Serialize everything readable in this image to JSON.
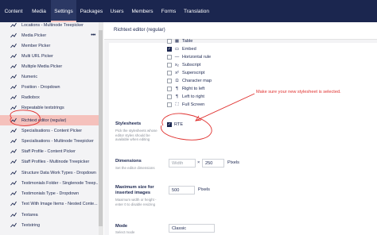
{
  "topnav": {
    "tabs": [
      "Content",
      "Media",
      "Settings",
      "Packages",
      "Users",
      "Members",
      "Forms",
      "Translation"
    ],
    "active": "Settings"
  },
  "sidebar": {
    "items": [
      {
        "label": "Locations - Multinode Treepicker"
      },
      {
        "label": "Media Picker"
      },
      {
        "label": "Member Picker"
      },
      {
        "label": "Multi URL Picker"
      },
      {
        "label": "Multiple Media Picker"
      },
      {
        "label": "Numeric"
      },
      {
        "label": "Position - Dropdown"
      },
      {
        "label": "Radiobox"
      },
      {
        "label": "Repeatable textstrings"
      },
      {
        "label": "Richtext editor (regular)"
      },
      {
        "label": "Specialisations - Content Picker"
      },
      {
        "label": "Specialisations - Multinode Treepicker"
      },
      {
        "label": "Staff Profile - Content Picker"
      },
      {
        "label": "Staff Profiles - Multinode Treepicker"
      },
      {
        "label": "Structure Data Work Types - Dropdown"
      },
      {
        "label": "Testimonials Folder - Singlenode Treep..."
      },
      {
        "label": "Testimonials Type - Dropdown"
      },
      {
        "label": "Text With Image Items - Nested Conte..."
      },
      {
        "label": "Textarea"
      },
      {
        "label": "Textstring"
      }
    ],
    "more_icon": "dots-icon"
  },
  "panel": {
    "title": "Richtext editor (regular)"
  },
  "toolbar_options": [
    {
      "label": "Table",
      "checked": false,
      "icon": "table-icon"
    },
    {
      "label": "Embed",
      "checked": true,
      "icon": "embed-icon"
    },
    {
      "label": "Horizontal rule",
      "checked": false,
      "icon": "hr-icon"
    },
    {
      "label": "Subscript",
      "checked": false,
      "icon": "subscript-icon"
    },
    {
      "label": "Superscript",
      "checked": false,
      "icon": "superscript-icon"
    },
    {
      "label": "Character map",
      "checked": false,
      "icon": "omega-icon"
    },
    {
      "label": "Right to left",
      "checked": false,
      "icon": "rtl-icon"
    },
    {
      "label": "Left to right",
      "checked": false,
      "icon": "ltr-icon"
    },
    {
      "label": "Full Screen",
      "checked": false,
      "icon": "fullscreen-icon"
    }
  ],
  "stylesheets": {
    "label": "Stylesheets",
    "desc": "Pick the stylesheets whose editor styles should be available when editing",
    "option": {
      "label": "RTE",
      "checked": true
    }
  },
  "dimensions": {
    "label": "Dimensions",
    "desc": "Set the editor dimensions",
    "width_placeholder": "Width",
    "separator": "×",
    "height_value": "250",
    "unit": "Pixels"
  },
  "max_size": {
    "label": "Maximum size for inserted images",
    "desc": "Maximum width or height - enter 0 to disable resizing",
    "value": "500",
    "unit": "Pixels"
  },
  "mode": {
    "label": "Mode",
    "desc": "Select mode",
    "value": "Classic"
  },
  "annotation": {
    "text": "Make sure your new stylesheet is selected.",
    "color": "#e0302e"
  },
  "colors": {
    "nav_bg": "#1b264f",
    "selected_item": "#f5c1bc",
    "accent_red": "#e0302e"
  }
}
